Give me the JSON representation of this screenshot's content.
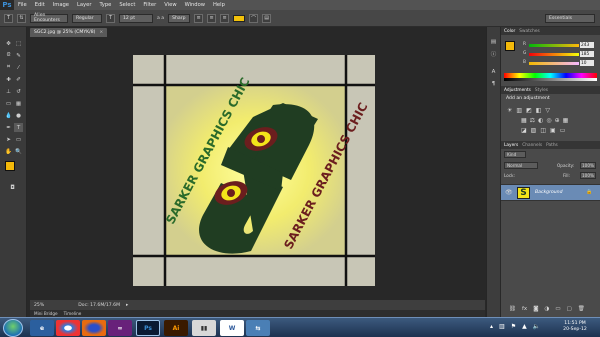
{
  "app": {
    "logo": "Ps",
    "menus": [
      "File",
      "Edit",
      "Image",
      "Layer",
      "Type",
      "Select",
      "Filter",
      "View",
      "Window",
      "Help"
    ]
  },
  "options_bar": {
    "font_family": "Alien Encounters",
    "font_style": "Regular",
    "font_size": "12 pt",
    "anti_alias": "Sharp",
    "aa_label": "a a",
    "workspace": "Essentials"
  },
  "document": {
    "tab_title": "SGC2.jpg @ 25% (CMYK/8)",
    "close": "×",
    "zoom": "25%",
    "doc_info": "Doc: 17.6M/17.6M",
    "canvas_text": "SARKER GRAPHICS CHIC",
    "canvas_letter": "C"
  },
  "bottom_tabs": [
    "Mini Bridge",
    "Timeline"
  ],
  "color_panel": {
    "tabs": [
      "Color",
      "Swatches"
    ],
    "channels": [
      {
        "label": "R",
        "value": "243"
      },
      {
        "label": "G",
        "value": "185"
      },
      {
        "label": "B",
        "value": "10"
      }
    ],
    "fg_color": "#f3b90a"
  },
  "adjustments_panel": {
    "tabs": [
      "Adjustments",
      "Styles"
    ],
    "heading": "Add an adjustment"
  },
  "layers_panel": {
    "tabs": [
      "Layers",
      "Channels",
      "Paths"
    ],
    "kind": "Kind",
    "blend": "Normal",
    "opacity_label": "Opacity:",
    "opacity": "100%",
    "lock_label": "Lock:",
    "fill_label": "Fill:",
    "fill": "100%",
    "layer_name": "Background"
  },
  "taskbar": {
    "time": "11:51 PM",
    "date": "20-Sep-12",
    "apps": [
      "ie",
      "chrome",
      "firefox",
      "vs",
      "ps",
      "ai",
      "explorer",
      "word",
      "network"
    ]
  },
  "colors": {
    "accent_yellow": "#f3d400",
    "dark_green": "#1e3b22",
    "maroon": "#6b1e1e",
    "layer_selected": "#6a8bb5"
  }
}
